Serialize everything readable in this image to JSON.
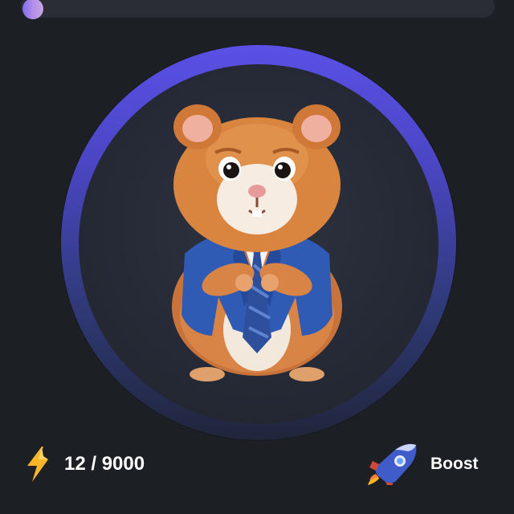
{
  "level": {
    "progress": 0.0
  },
  "tap_target": {
    "character": "hamster-ceo"
  },
  "energy": {
    "icon": "lightning-icon",
    "text": "12 / 9000",
    "current": 12,
    "max": 9000
  },
  "boost": {
    "icon": "rocket-icon",
    "label": "Boost"
  },
  "colors": {
    "background": "#1c1f24",
    "ring_top": "#5a50e6",
    "ring_bottom": "#20253a",
    "energy": "#f7b52a",
    "text": "#ffffff"
  }
}
